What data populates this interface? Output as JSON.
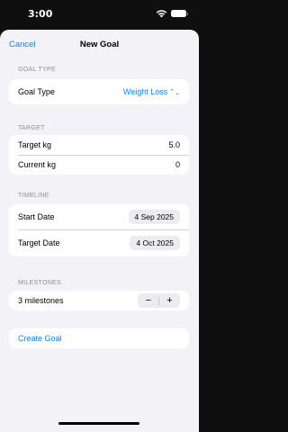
{
  "status": {
    "time": "3:00"
  },
  "nav": {
    "cancel": "Cancel",
    "title": "New Goal"
  },
  "sections": {
    "goal_type": {
      "header": "GOAL TYPE",
      "label": "Goal Type",
      "value": "Weight Loss"
    },
    "target": {
      "header": "TARGET",
      "target_label": "Target kg",
      "target_value": "5.0",
      "current_label": "Current kg",
      "current_value": "0"
    },
    "timeline": {
      "header": "TIMELINE",
      "start_label": "Start Date",
      "start_value": "4 Sep 2025",
      "target_label": "Target Date",
      "target_value": "4 Oct 2025"
    },
    "milestones": {
      "header": "MILESTONES",
      "label": "3 milestones",
      "minus": "−",
      "plus": "+"
    }
  },
  "actions": {
    "create": "Create Goal"
  },
  "colors": {
    "accent": "#0a84ff",
    "background": "#f2f2f7"
  },
  "icons": [
    "wifi-icon",
    "battery-icon",
    "chevron-up-down-icon"
  ]
}
